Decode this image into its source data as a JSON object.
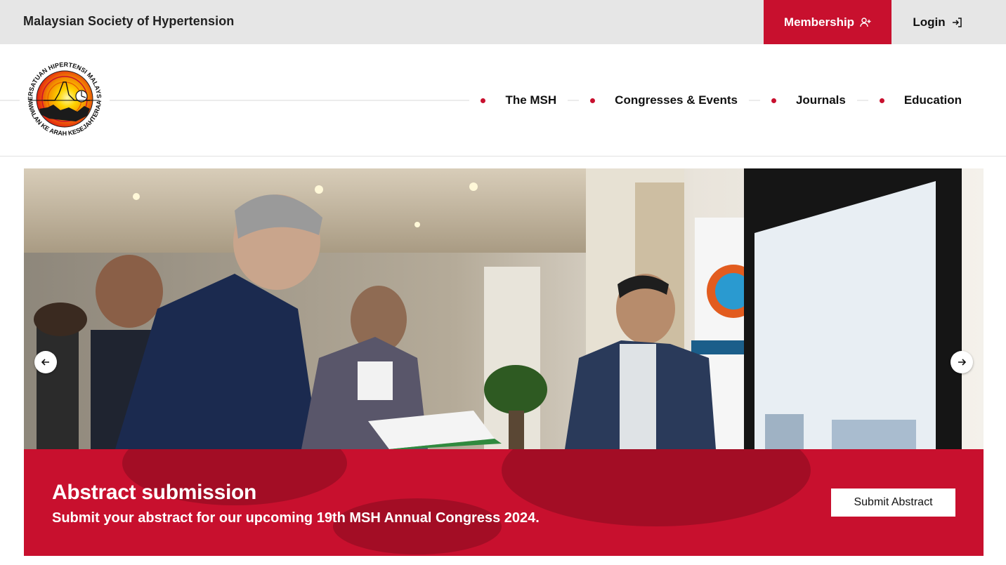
{
  "topbar": {
    "org_name": "Malaysian Society of Hypertension",
    "membership_label": "Membership",
    "membership_icon": "user-plus-icon",
    "login_label": "Login",
    "login_icon": "login-arrow-icon"
  },
  "logo": {
    "top_text": "PERSATUAN HIPERTENSI MALAYSIA",
    "bottom_text": "KAWALAN KE ARAH KESEJAHTERAAN"
  },
  "nav": {
    "items": [
      {
        "label": "The MSH"
      },
      {
        "label": "Congresses & Events"
      },
      {
        "label": "Journals"
      },
      {
        "label": "Education"
      }
    ]
  },
  "hero": {
    "title": "Abstract submission",
    "subtitle": "Submit your abstract for our upcoming 19th MSH Annual Congress 2024.",
    "button_label": "Submit Abstract",
    "prev_icon": "arrow-left-icon",
    "next_icon": "arrow-right-icon"
  },
  "colors": {
    "brand_red": "#c8102e",
    "topbar_bg": "#e6e6e6"
  }
}
